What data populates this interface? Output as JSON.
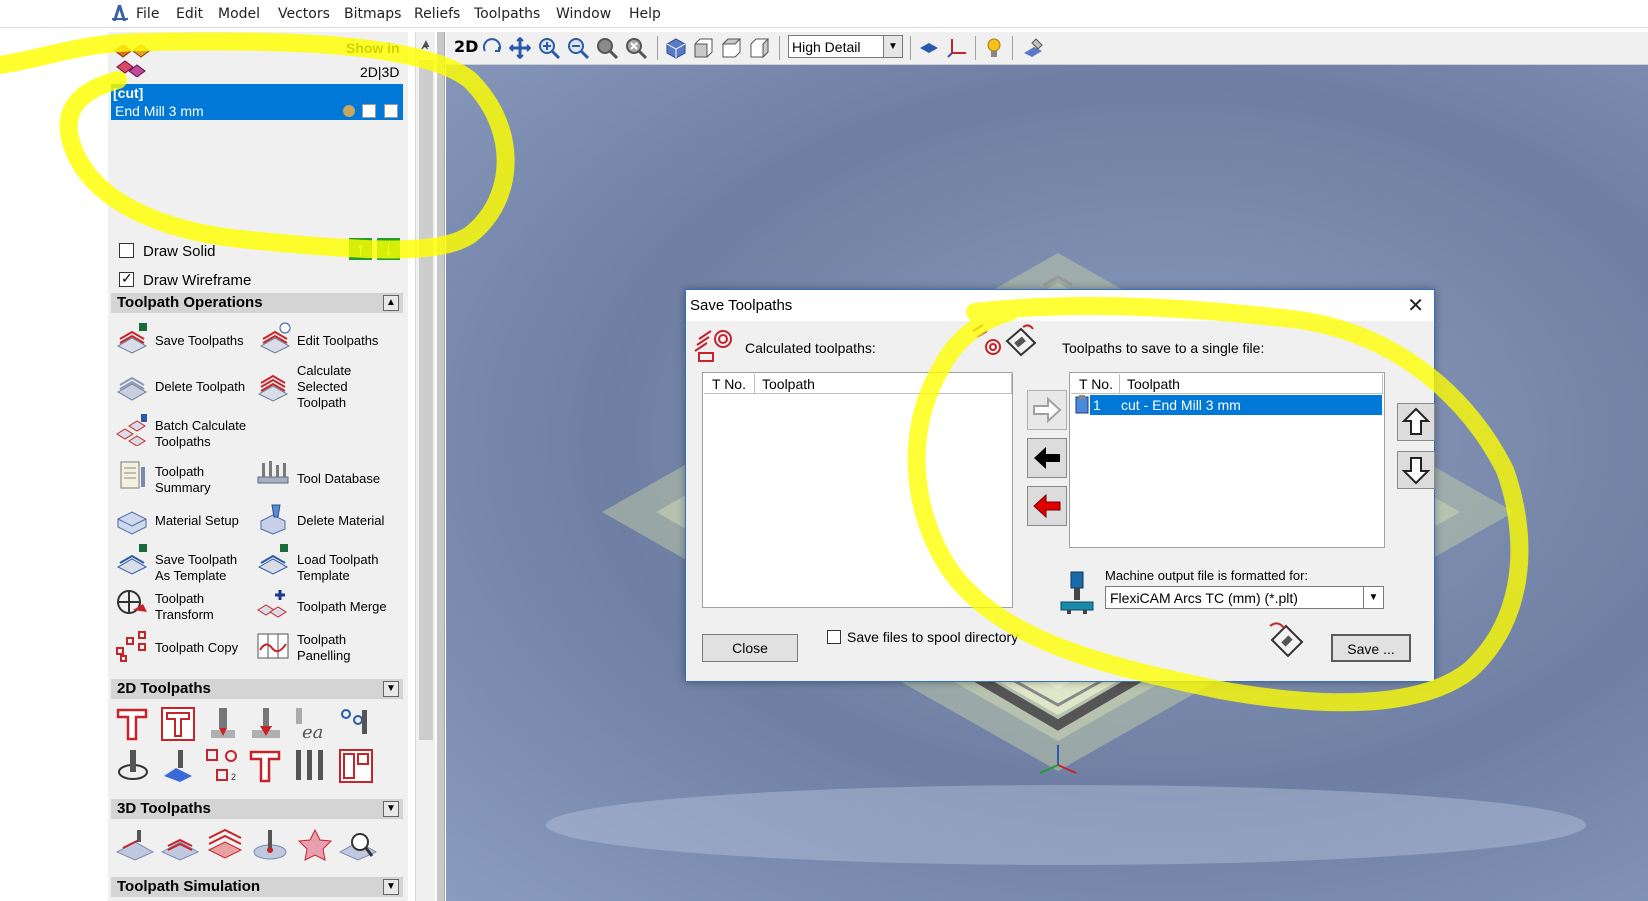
{
  "menubar": {
    "items": [
      "File",
      "Edit",
      "Model",
      "Vectors",
      "Bitmaps",
      "Reliefs",
      "Toolpaths",
      "Window",
      "Help"
    ]
  },
  "layers": {
    "show_in_label": "Show in",
    "mode_label": "2D|3D",
    "group_name": "[cut]",
    "tool_name": "End Mill 3 mm"
  },
  "options": {
    "draw_solid": "Draw Solid",
    "draw_wireframe": "Draw Wireframe",
    "draw_solid_checked": false,
    "draw_wireframe_checked": true
  },
  "sections": {
    "toolpath_operations": "Toolpath Operations",
    "toolpaths_2d": "2D Toolpaths",
    "toolpaths_3d": "3D Toolpaths",
    "simulation": "Toolpath Simulation"
  },
  "operations": {
    "save_toolpaths": "Save Toolpaths",
    "edit_toolpaths": "Edit Toolpaths",
    "delete_toolpath": "Delete Toolpath",
    "calculate_selected": [
      "Calculate",
      "Selected",
      "Toolpath"
    ],
    "batch_calculate": [
      "Batch Calculate",
      "Toolpaths"
    ],
    "toolpath_summary": [
      "Toolpath",
      "Summary"
    ],
    "tool_database": "Tool Database",
    "material_setup": "Material Setup",
    "delete_material": "Delete Material",
    "save_template": [
      "Save Toolpath",
      "As Template"
    ],
    "load_template": [
      "Load Toolpath",
      "Template"
    ],
    "toolpath_transform": [
      "Toolpath",
      "Transform"
    ],
    "toolpath_merge": "Toolpath Merge",
    "toolpath_copy": "Toolpath Copy",
    "toolpath_panelling": [
      "Toolpath",
      "Panelling"
    ]
  },
  "view_toolbar": {
    "mode_2d": "2D",
    "detail_level": "High Detail"
  },
  "dialog": {
    "title": "Save Toolpaths",
    "calculated_label": "Calculated toolpaths:",
    "save_single_label": "Toolpaths to save to a single file:",
    "col_tno": "T No.",
    "col_toolpath": "Toolpath",
    "saved_rows": [
      {
        "tno": "1",
        "name": "cut - End Mill 3 mm"
      }
    ],
    "machine_label": "Machine output file is formatted for:",
    "machine_value": "FlexiCAM Arcs TC (mm) (*.plt)",
    "close_label": "Close",
    "spool_label": "Save files to spool directory",
    "spool_checked": false,
    "save_label": "Save ..."
  },
  "colors": {
    "selection": "#0078d7",
    "highlight": "#ffff00",
    "viewport": "#7f8fb2"
  }
}
